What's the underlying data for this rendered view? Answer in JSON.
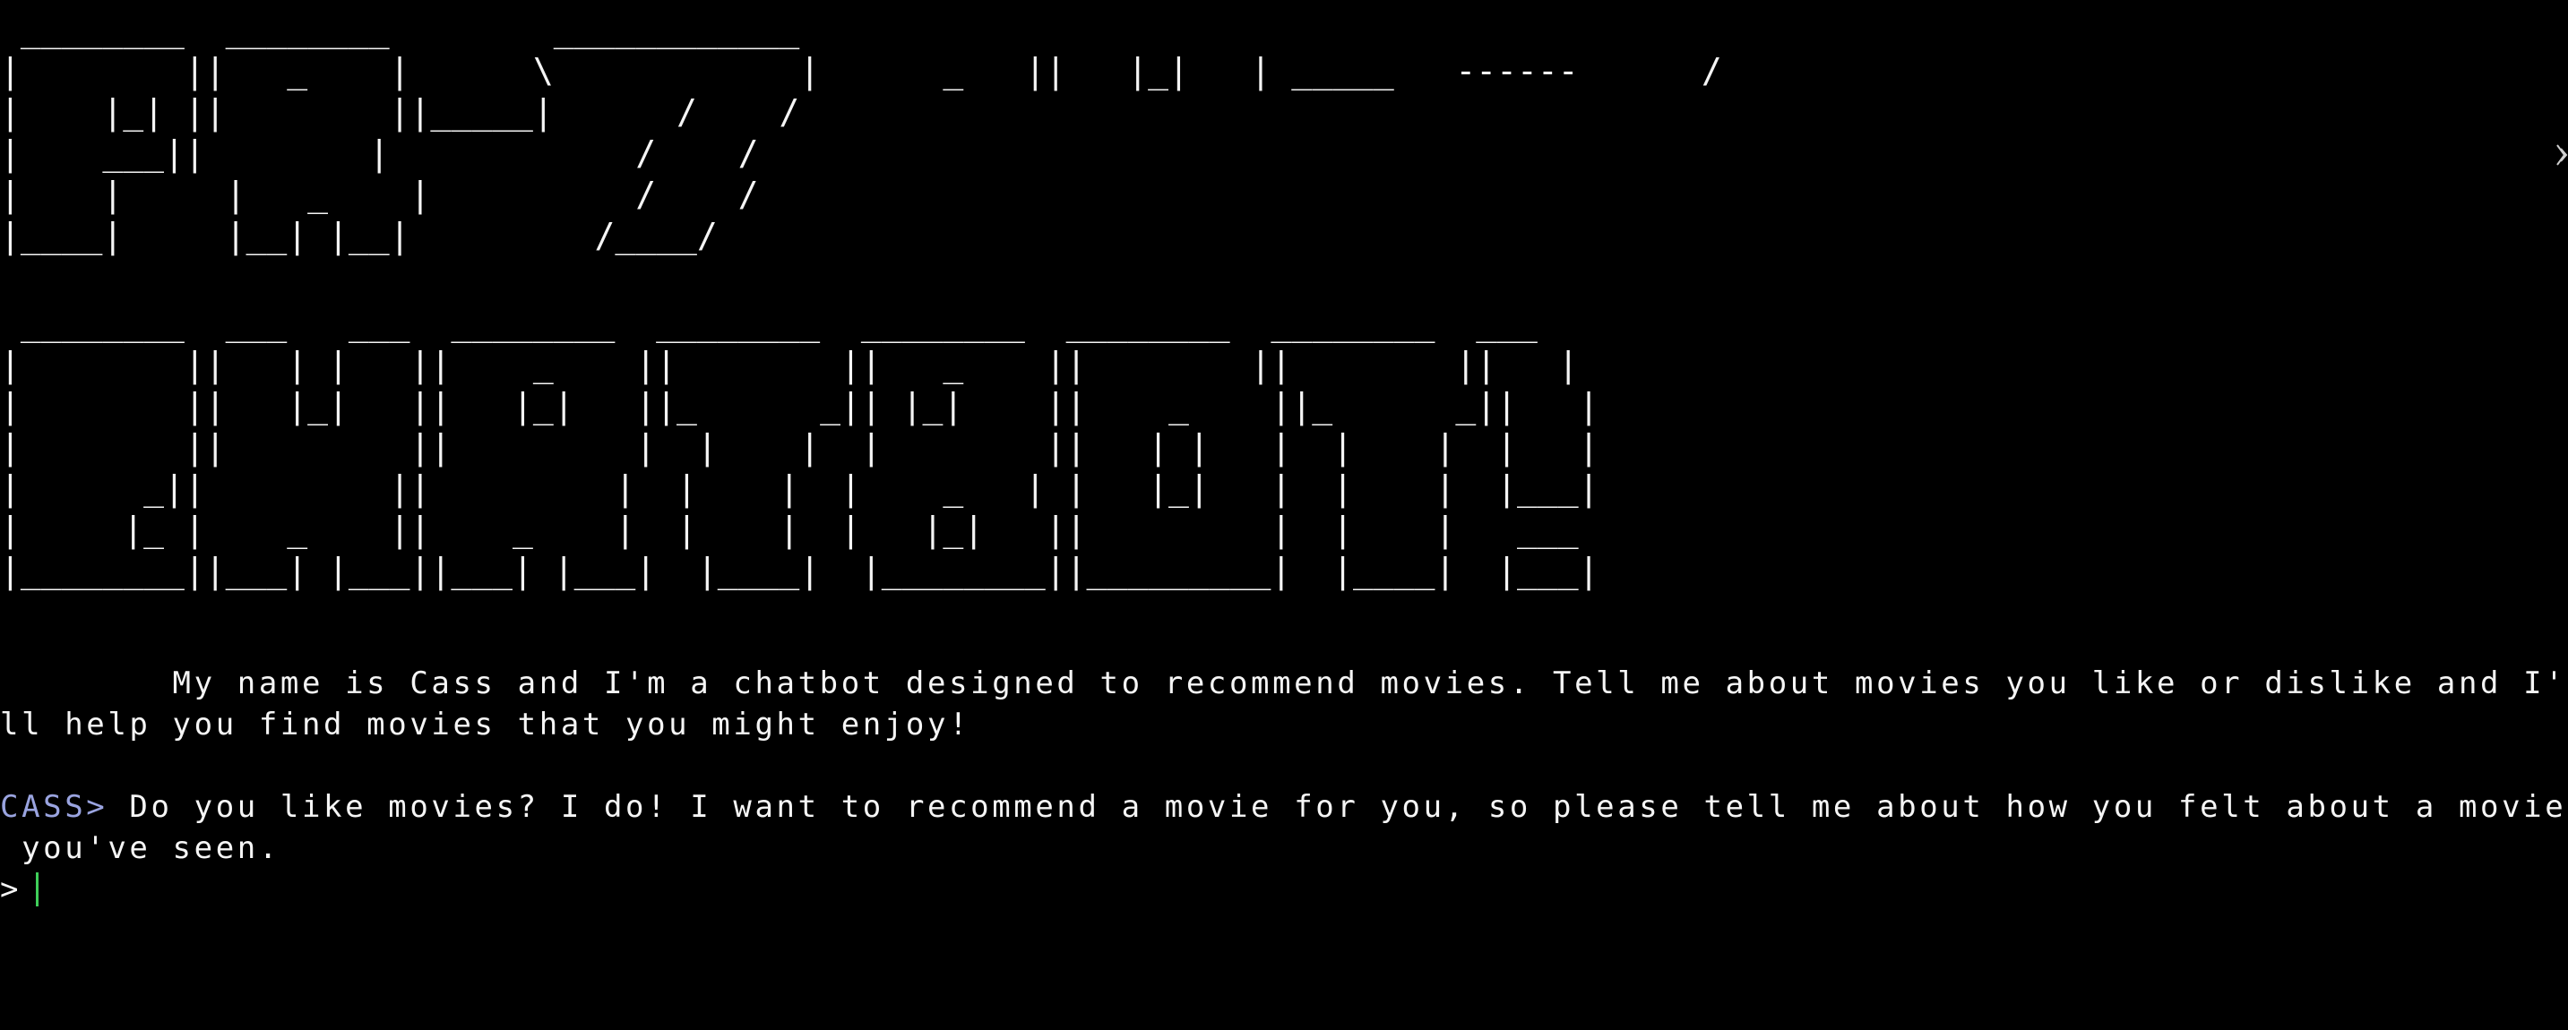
{
  "terminal": {
    "banner_top": " ________  ________        ____________\n|        ||   _    |      \\            |      _   ||   |_|   | _____   ------      /\n|    |_| ||        ||_____|      /    /\n|    ___||        |            /    /\n|    |     |   _    |          /    /\n|____|     |__| |__|         /____/",
    "banner_bottom": " ________  ___   ___  ________  ________  ________  ________  ________  ___\n|        ||   | |   ||    _    ||        ||   _    ||        ||        ||   |\n|        ||   |_|   ||   |_|   ||_      _|| |_|    ||    _    ||_      _||   |\n|        ||         ||         |  |    |  |        ||   | |   |  |    |  |   |\n|      _||         ||         |  |    |  |    _   | |   |_|   |  |    |  |___|\n|     |_ |    _    ||    _    |  |    |  |   |_|   ||         |  |    |   ___\n|________||___| |___||___| |___|  |____|  |________||_________|  |____|  |___|",
    "intro_line1": "        My name is Cass and I'm a chatbot designed to recommend movies. Tell me about movies you like or dislike and I'",
    "intro_line2": "ll help you find movies that you might enjoy!",
    "bot_name": "CASS>",
    "bot_line1": " Do you like movies? I do! I want to recommend a movie for you, so please tell me about how you felt about a movie",
    "bot_line2": " you've seen.",
    "input_prompt": ">",
    "input_value": ""
  },
  "colors": {
    "background": "#000000",
    "text": "#f5f5f5",
    "prompt_name": "#9aa4e0",
    "cursor": "#3fcf5a"
  }
}
